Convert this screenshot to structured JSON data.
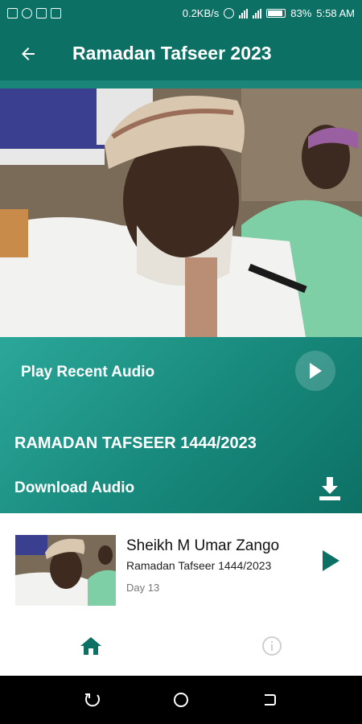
{
  "status_bar": {
    "speed": "0.2KB/s",
    "battery": "83%",
    "time": "5:58 AM"
  },
  "app_bar": {
    "title": "Ramadan Tafseer 2023",
    "back_icon": "arrow-left-icon"
  },
  "player_panel": {
    "play_recent_label": "Play Recent Audio",
    "series_title": "RAMADAN TAFSEER 1444/2023",
    "download_label": "Download Audio",
    "download_icon": "download-icon"
  },
  "episodes": [
    {
      "title": "Sheikh M Umar Zango",
      "subtitle": "Ramadan Tafseer 1444/2023",
      "day": "Day 13"
    }
  ],
  "bottom_nav": {
    "items": [
      {
        "icon": "home-icon",
        "active": true
      },
      {
        "icon": "info-icon",
        "active": false
      }
    ]
  },
  "colors": {
    "primary": "#0d7065",
    "panel_light": "#2ba799",
    "active_nav": "#0d7065",
    "inactive_nav": "#cfcfcf"
  }
}
